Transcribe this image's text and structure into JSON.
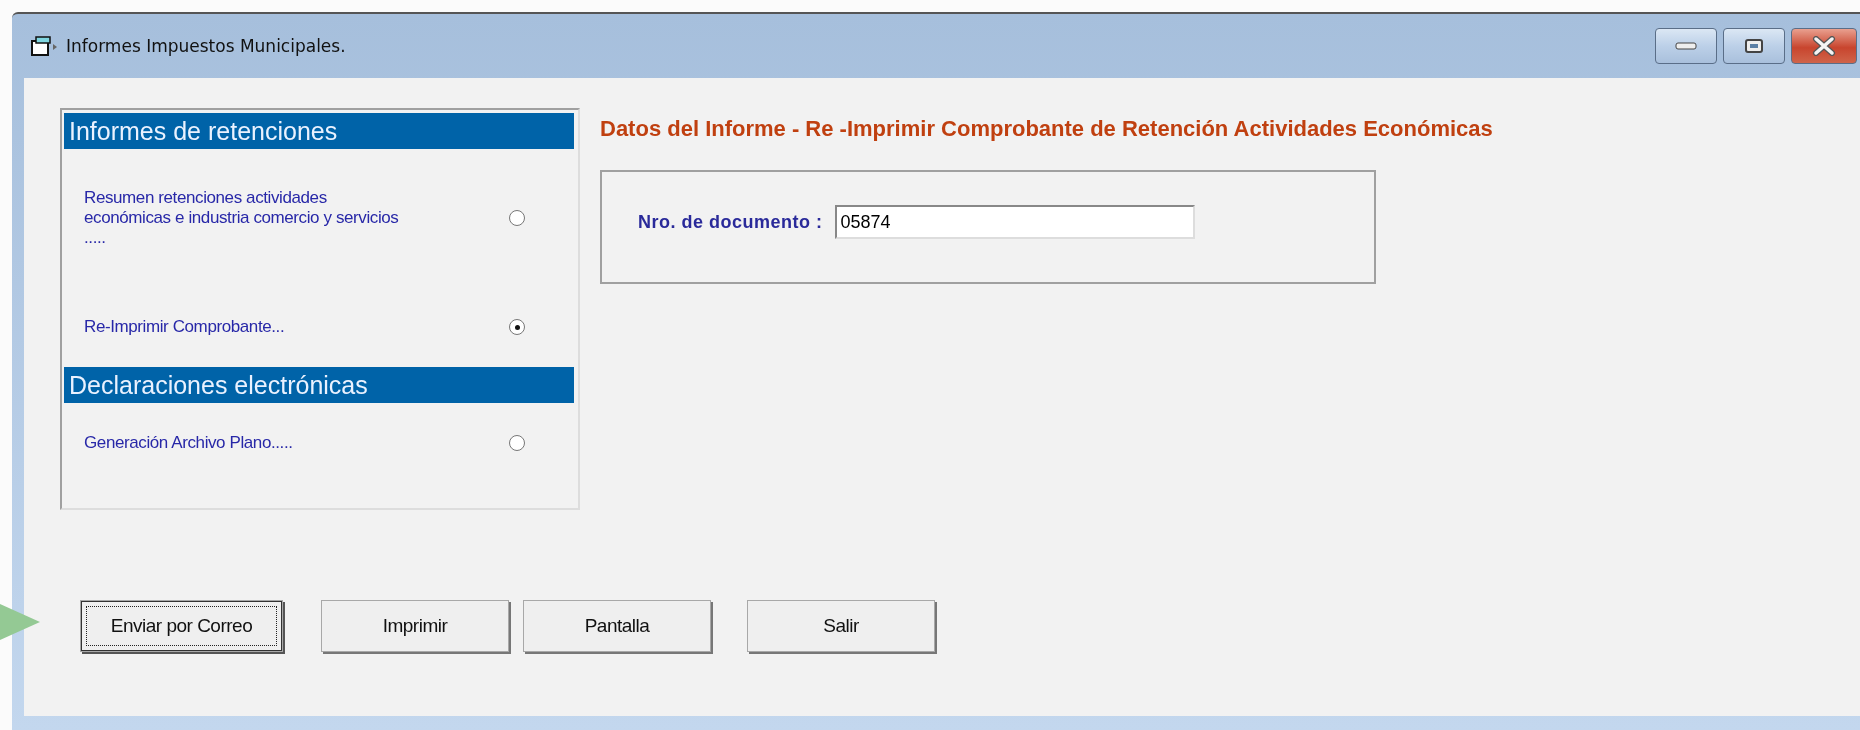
{
  "window": {
    "title": "Informes Impuestos Municipales."
  },
  "sections": [
    {
      "title": "Informes de retenciones",
      "items": [
        {
          "label": "Resumen retenciones actividades económicas e industria comercio y servicios .....",
          "selected": false
        },
        {
          "label": "Re-Imprimir Comprobante...",
          "selected": true
        }
      ]
    },
    {
      "title": "Declaraciones electrónicas",
      "items": [
        {
          "label": "Generación Archivo Plano.....",
          "selected": false
        }
      ]
    }
  ],
  "report": {
    "heading": "Datos del Informe - Re -Imprimir Comprobante de Retención Actividades Económicas",
    "field_label": "Nro. de documento :",
    "field_value": "05874"
  },
  "buttons": [
    {
      "label": "Enviar por Correo",
      "focused": true
    },
    {
      "label": "Imprimir",
      "focused": false
    },
    {
      "label": "Pantalla",
      "focused": false
    },
    {
      "label": "Salir",
      "focused": false
    }
  ]
}
